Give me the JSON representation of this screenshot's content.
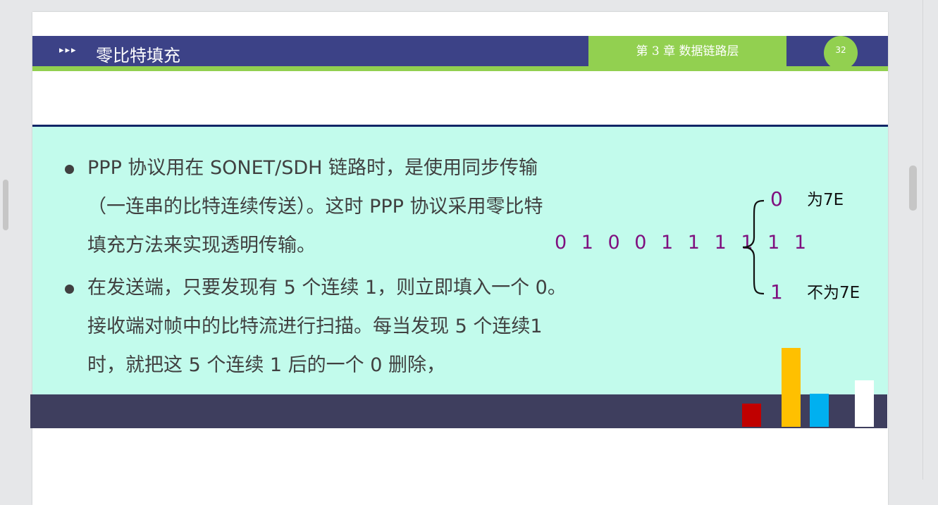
{
  "slide": {
    "header": {
      "arrows": "▸▸▸",
      "title": "零比特填充",
      "chapter": "第 3 章  数据链路层",
      "page_number": "32"
    },
    "bullets": [
      {
        "lines": [
          "PPP 协议用在 SONET/SDH 链路时，是使用同步传输",
          "（一连串的比特连续传送）。这时 PPP 协议采用零比特",
          "填充方法来实现透明传输。"
        ]
      },
      {
        "lines": [
          "在发送端，只要发现有 5 个连续 1，则立即填入一个 0。",
          "接收端对帧中的比特流进行扫描。每当发现 5 个连续1",
          "时，就把这 5 个连续 1 后的一个 0 删除，"
        ]
      }
    ],
    "diagram": {
      "bit_sequence": "0 1 0 0 1 1 1 1 1 1",
      "branch_top_bit": "0",
      "branch_top_label": "为7E",
      "branch_bottom_bit": "1",
      "branch_bottom_label": "不为7E"
    }
  },
  "colors": {
    "header_bg": "#3c4287",
    "accent_green": "#92d050",
    "content_bg": "#c2fbec",
    "footer_bg": "#3e3e5e",
    "bit_color": "#7f0f7f",
    "deco_bars": [
      "#c00000",
      "#ffc000",
      "#00b0f0",
      "#ffffff"
    ]
  },
  "icons": [
    "bullet-dot-icon",
    "curly-brace-icon"
  ]
}
